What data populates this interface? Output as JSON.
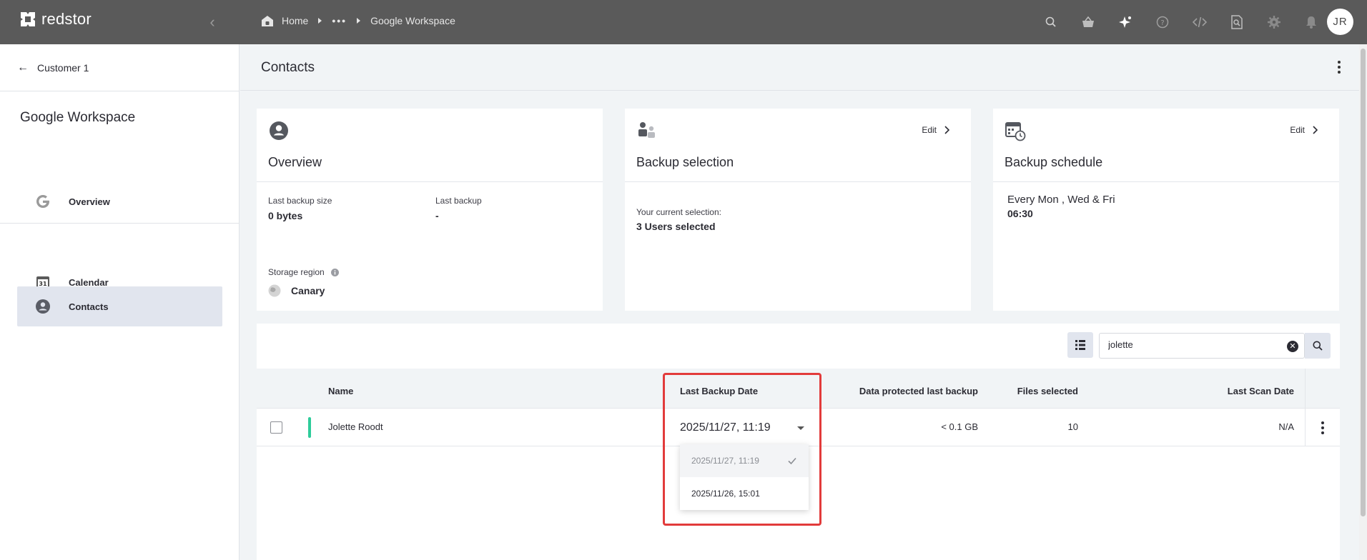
{
  "app": {
    "logo_text": "redstor",
    "user_initials": "JR"
  },
  "breadcrumb": {
    "home": "Home",
    "ellipsis": "•••",
    "current": "Google Workspace"
  },
  "sidebar": {
    "back_label": "Customer 1",
    "section_title": "Google Workspace",
    "items": [
      {
        "label": "Overview",
        "icon": "google-icon"
      },
      {
        "label": "Calendar",
        "icon": "calendar-icon",
        "icon_text": "31"
      },
      {
        "label": "Contacts",
        "icon": "contact-icon",
        "active": true
      }
    ]
  },
  "page": {
    "title": "Contacts"
  },
  "cards": {
    "overview": {
      "title": "Overview",
      "last_backup_size_label": "Last backup size",
      "last_backup_size_value": "0 bytes",
      "last_backup_label": "Last backup",
      "last_backup_value": "-",
      "storage_region_label": "Storage region",
      "storage_region_value": "Canary"
    },
    "backup_selection": {
      "title": "Backup selection",
      "edit_label": "Edit",
      "selection_label": "Your current selection:",
      "selection_value": "3 Users selected"
    },
    "backup_schedule": {
      "title": "Backup schedule",
      "edit_label": "Edit",
      "days": "Every Mon , Wed & Fri",
      "time": "06:30"
    }
  },
  "search": {
    "value": "jolette"
  },
  "table": {
    "columns": {
      "name": "Name",
      "last_backup_date": "Last Backup Date",
      "data_protected": "Data protected last backup",
      "files_selected": "Files selected",
      "last_scan_date": "Last Scan Date"
    },
    "rows": [
      {
        "name": "Jolette Roodt",
        "last_backup_date": "2025/11/27, 11:19",
        "data_protected": "< 0.1 GB",
        "files_selected": "10",
        "last_scan_date": "N/A",
        "status_color": "#2ecc9a"
      }
    ]
  },
  "date_dropdown": {
    "options": [
      "2025/11/27, 11:19",
      "2025/11/26, 15:01"
    ],
    "selected_index": 0
  },
  "colors": {
    "topbar": "#5a5a5a",
    "active_item": "#e1e5ee",
    "status_green": "#2ecc9a",
    "highlight_red": "#e23b3b"
  }
}
